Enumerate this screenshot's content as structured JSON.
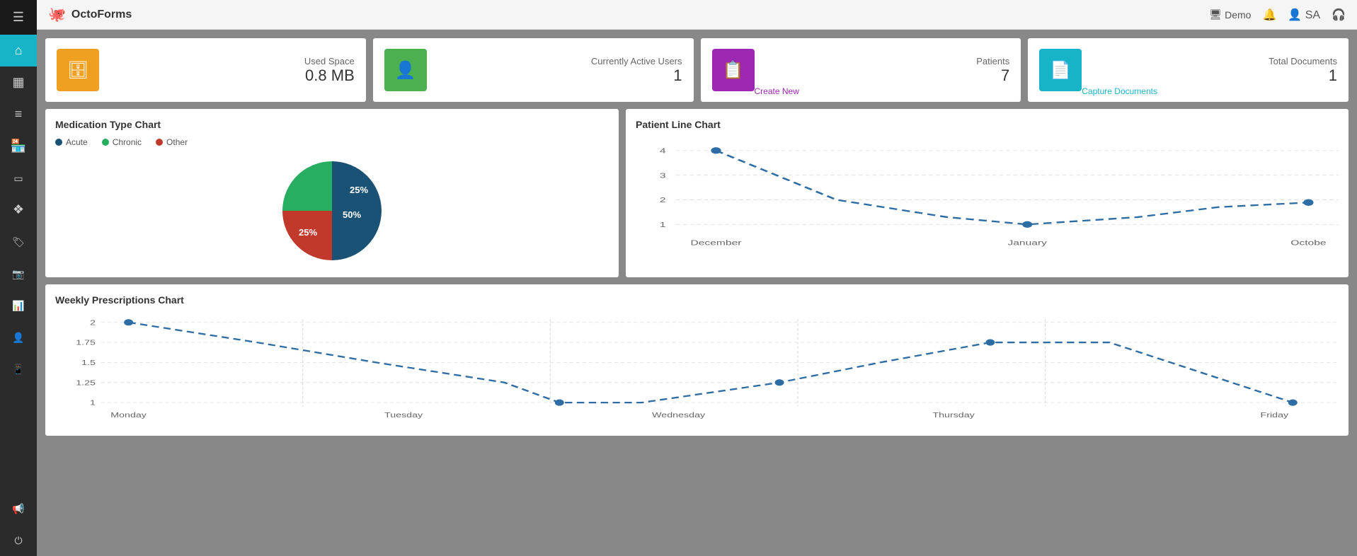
{
  "app": {
    "name": "OctoForms",
    "logo_icon": "🐙"
  },
  "header": {
    "demo_label": "Demo",
    "user_label": "SA"
  },
  "sidebar": {
    "items": [
      {
        "id": "menu",
        "icon": "☰",
        "label": "Menu"
      },
      {
        "id": "home",
        "icon": "⌂",
        "label": "Home"
      },
      {
        "id": "grid",
        "icon": "▦",
        "label": "Grid"
      },
      {
        "id": "list",
        "icon": "≡",
        "label": "List"
      },
      {
        "id": "chart-bar",
        "icon": "📊",
        "label": "Chart"
      },
      {
        "id": "window",
        "icon": "▭",
        "label": "Window"
      },
      {
        "id": "layers",
        "icon": "❖",
        "label": "Layers"
      },
      {
        "id": "tag",
        "icon": "🏷",
        "label": "Tag"
      },
      {
        "id": "camera",
        "icon": "📷",
        "label": "Camera"
      },
      {
        "id": "chart2",
        "icon": "📈",
        "label": "Analytics"
      },
      {
        "id": "user",
        "icon": "👤",
        "label": "User"
      },
      {
        "id": "phone",
        "icon": "📱",
        "label": "Phone"
      },
      {
        "id": "megaphone",
        "icon": "📢",
        "label": "Megaphone"
      },
      {
        "id": "power",
        "icon": "⏻",
        "label": "Power"
      }
    ]
  },
  "stat_cards": [
    {
      "id": "used-space",
      "icon": "🗄",
      "icon_color": "orange",
      "label": "Used Space",
      "value": "0.8 MB",
      "link": null
    },
    {
      "id": "active-users",
      "icon": "👤",
      "icon_color": "green",
      "label": "Currently Active Users",
      "value": "1",
      "link": null
    },
    {
      "id": "patients",
      "icon": "📋",
      "icon_color": "purple",
      "label": "Patients",
      "value": "7",
      "link": "Create New"
    },
    {
      "id": "total-documents",
      "icon": "📄",
      "icon_color": "teal",
      "label": "Total Documents",
      "value": "1",
      "link": "Capture Documents"
    }
  ],
  "medication_chart": {
    "title": "Medication Type Chart",
    "legend": [
      {
        "label": "Acute",
        "color": "#1a5276"
      },
      {
        "label": "Chronic",
        "color": "#27ae60"
      },
      {
        "label": "Other",
        "color": "#c0392b"
      }
    ],
    "slices": [
      {
        "label": "50%",
        "value": 50,
        "color": "#1a5276"
      },
      {
        "label": "25%",
        "value": 25,
        "color": "#c0392b"
      },
      {
        "label": "25%",
        "value": 25,
        "color": "#27ae60"
      }
    ]
  },
  "patient_chart": {
    "title": "Patient Line Chart",
    "y_labels": [
      "1",
      "2",
      "3",
      "4"
    ],
    "x_labels": [
      "December",
      "January",
      "Octobe"
    ],
    "points": [
      {
        "x": 0,
        "y": 4
      },
      {
        "x": 0.35,
        "y": 1.8
      },
      {
        "x": 0.5,
        "y": 1.2
      },
      {
        "x": 0.65,
        "y": 1.0
      },
      {
        "x": 0.8,
        "y": 1.1
      },
      {
        "x": 1.0,
        "y": 2.0
      }
    ]
  },
  "weekly_chart": {
    "title": "Weekly Prescriptions Chart",
    "y_labels": [
      "1",
      "1.25",
      "1.5",
      "1.75",
      "2"
    ],
    "x_labels": [
      "Monday",
      "Tuesday",
      "Wednesday",
      "Thursday",
      "Friday"
    ],
    "points": [
      {
        "x": 0,
        "y": 2.0
      },
      {
        "x": 0.15,
        "y": 1.75
      },
      {
        "x": 0.25,
        "y": 1.5
      },
      {
        "x": 0.35,
        "y": 1.25
      },
      {
        "x": 0.5,
        "y": 1.0
      },
      {
        "x": 0.6,
        "y": 1.0
      },
      {
        "x": 0.7,
        "y": 1.1
      },
      {
        "x": 0.8,
        "y": 1.5
      },
      {
        "x": 0.87,
        "y": 1.75
      },
      {
        "x": 0.93,
        "y": 1.75
      },
      {
        "x": 1.0,
        "y": 1.0
      }
    ]
  }
}
